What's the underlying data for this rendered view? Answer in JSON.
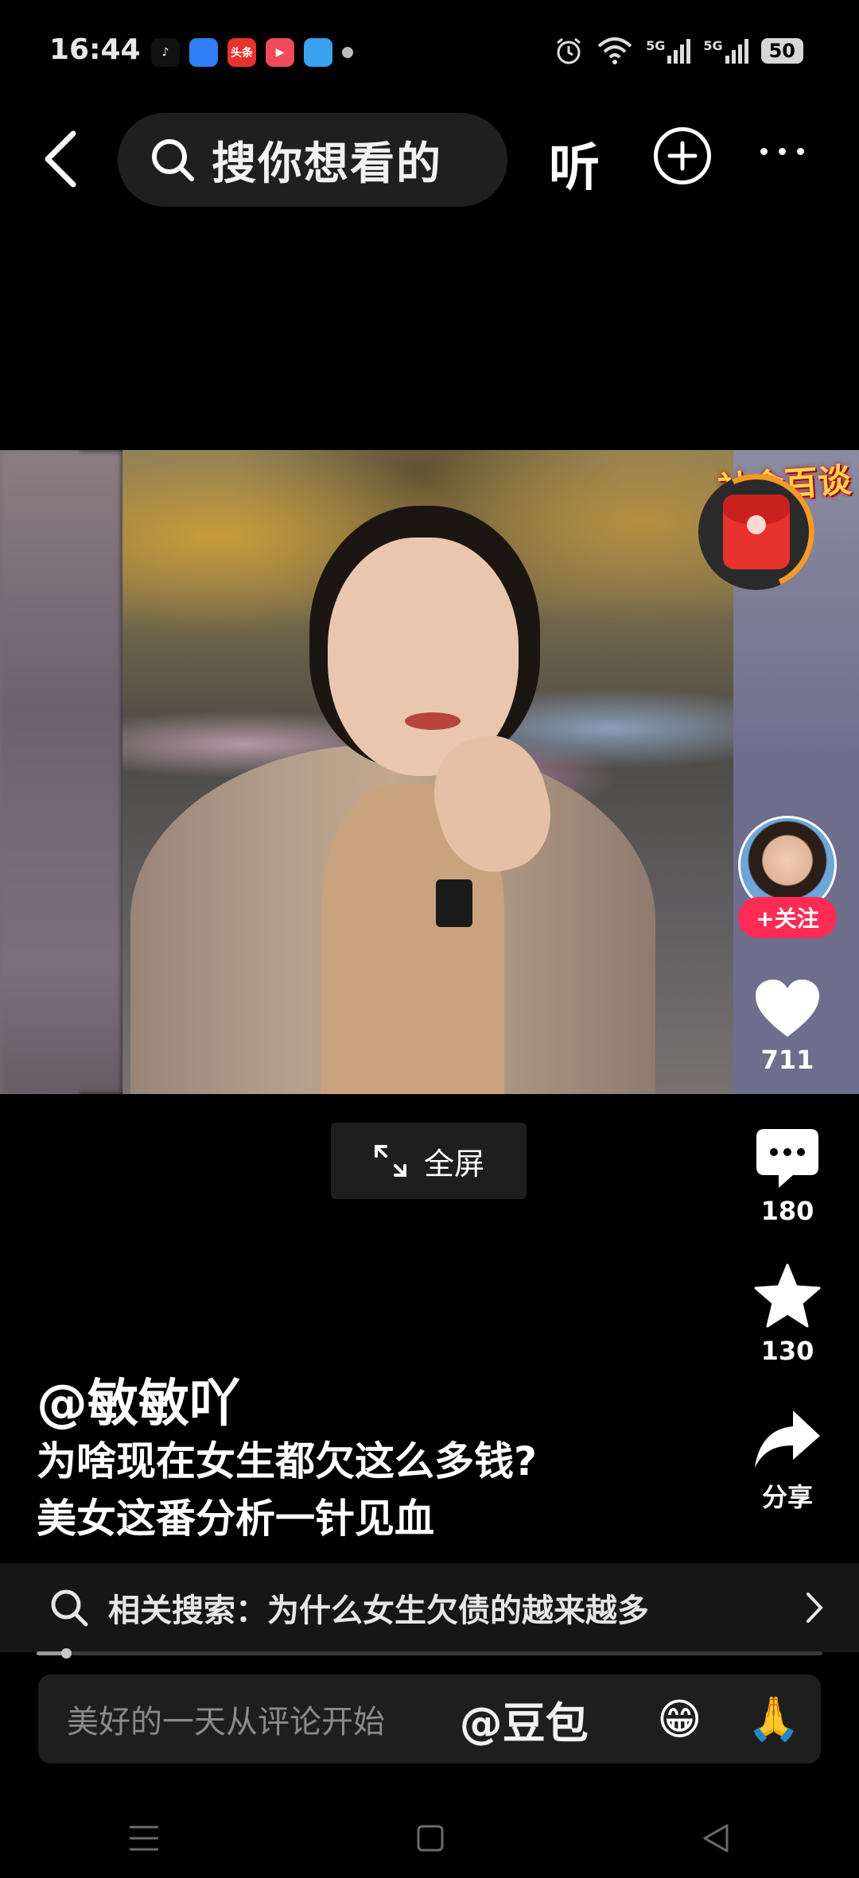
{
  "status_bar": {
    "time": "16:44",
    "app_icons": [
      {
        "name": "tiktok-icon",
        "glyph": "♪",
        "bg": "#111111"
      },
      {
        "name": "browser-icon",
        "glyph": "",
        "bg": "#2f7ef5"
      },
      {
        "name": "toutiao-icon",
        "glyph": "头条",
        "bg": "#e8322e"
      },
      {
        "name": "video-app-icon",
        "glyph": "▶",
        "bg": "#ef4b5a"
      },
      {
        "name": "wallet-icon",
        "glyph": "",
        "bg": "#3aa0f0"
      }
    ],
    "network_1": "5G",
    "network_2": "5G",
    "battery": "50"
  },
  "top_nav": {
    "search_placeholder": "搜你想看的",
    "listen_label": "听"
  },
  "video": {
    "overlay_logo": "社会百谈"
  },
  "rail": {
    "follow_label": "+关注",
    "like_count": "711",
    "comment_count": "180",
    "favorite_count": "130",
    "share_label": "分享"
  },
  "fullscreen_label": "全屏",
  "post": {
    "author": "@敏敏吖",
    "caption": "为啥现在女生都欠这么多钱?\n美女这番分析一针见血"
  },
  "related_search": {
    "label": "相关搜索：为什么女生欠债的越来越多"
  },
  "playback_progress": 0.037,
  "comment_bar": {
    "placeholder": "美好的一天从评论开始",
    "mention": "@豆包",
    "emoji_1": "😁",
    "emoji_2": "🙏"
  },
  "colors": {
    "accent": "#fe2c55",
    "background": "#000000"
  }
}
